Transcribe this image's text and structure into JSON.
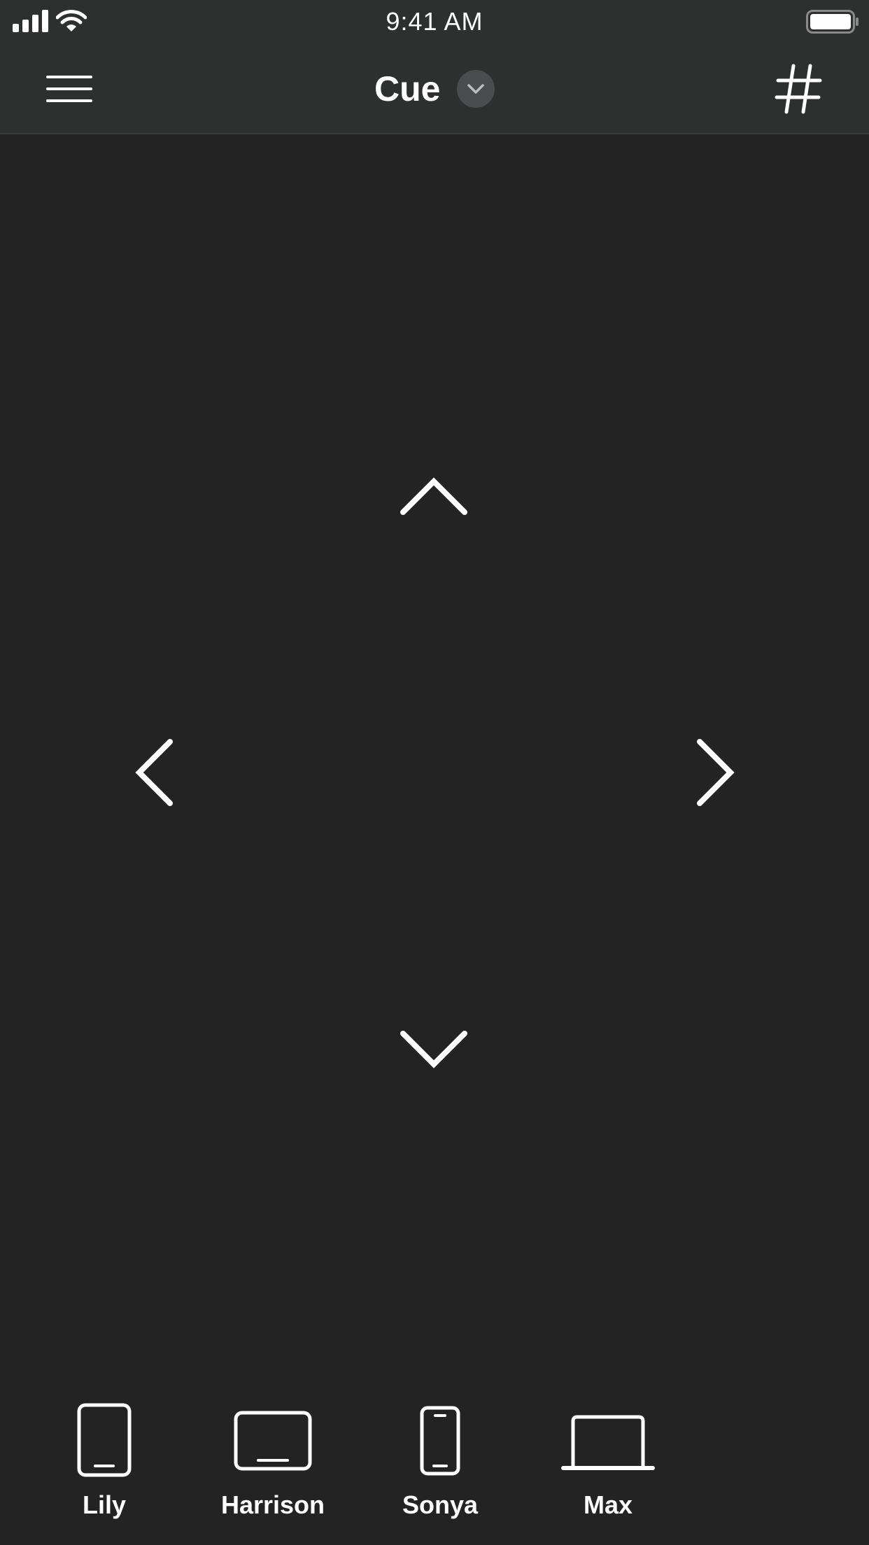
{
  "status_bar": {
    "time": "9:41 AM",
    "icons": [
      "signal-icon",
      "wifi-icon",
      "battery-icon"
    ]
  },
  "nav": {
    "menu_icon": "hamburger-menu-icon",
    "title": "Cue",
    "dropdown_icon": "chevron-down-icon",
    "right_icon": "hash-grid-icon"
  },
  "dpad": {
    "up_icon": "chevron-up-icon",
    "down_icon": "chevron-down-icon",
    "left_icon": "chevron-left-icon",
    "right_icon": "chevron-right-icon"
  },
  "devices": [
    {
      "label": "Lily",
      "icon": "tablet-portrait-icon"
    },
    {
      "label": "Harrison",
      "icon": "tablet-landscape-icon"
    },
    {
      "label": "Sonya",
      "icon": "phone-icon"
    },
    {
      "label": "Max",
      "icon": "laptop-icon"
    }
  ],
  "colors": {
    "background": "#232323",
    "bar": "#2e2f2f",
    "foreground": "#ffffff",
    "dropdown_bg": "#4b4c4e"
  }
}
